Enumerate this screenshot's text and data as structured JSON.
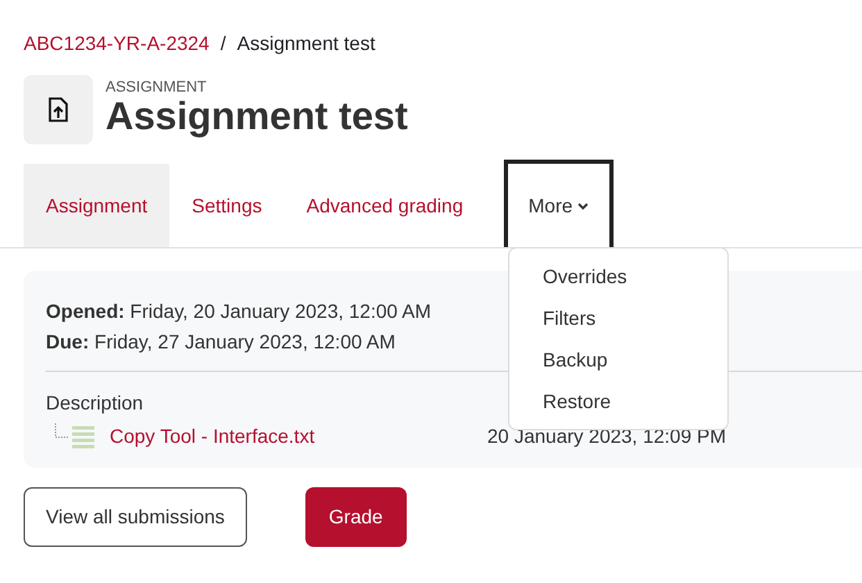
{
  "breadcrumb": [
    {
      "label": "ABC1234-YR-A-2324",
      "kind": "link"
    },
    {
      "label": "/",
      "kind": "separator"
    },
    {
      "label": "Assignment test",
      "kind": "current"
    }
  ],
  "header": {
    "pretitle": "ASSIGNMENT",
    "title": "Assignment test"
  },
  "tabs": [
    {
      "label": "Assignment",
      "selected": true,
      "kind": "tab"
    },
    {
      "label": "Settings",
      "selected": false,
      "kind": "tab"
    },
    {
      "label": "Advanced grading",
      "selected": false,
      "kind": "tab"
    },
    {
      "label": "More",
      "selected": false,
      "kind": "menu",
      "expanded": true
    }
  ],
  "menu": {
    "items": [
      "Overrides",
      "Filters",
      "Backup",
      "Restore"
    ]
  },
  "dates": [
    "**Opened:** Friday, 20 January 2023, 12:00 AM",
    "**Due:** Friday, 27 January 2023, 12:00 AM"
  ],
  "description": {
    "label": "Description",
    "file": {
      "name": "Copy Tool - Interface.txt",
      "date": "20 January 2023, 12:09 PM"
    }
  },
  "buttons": [
    {
      "label": "View all submissions",
      "kind": "outline"
    },
    {
      "label": "Grade",
      "kind": "primary"
    }
  ]
}
